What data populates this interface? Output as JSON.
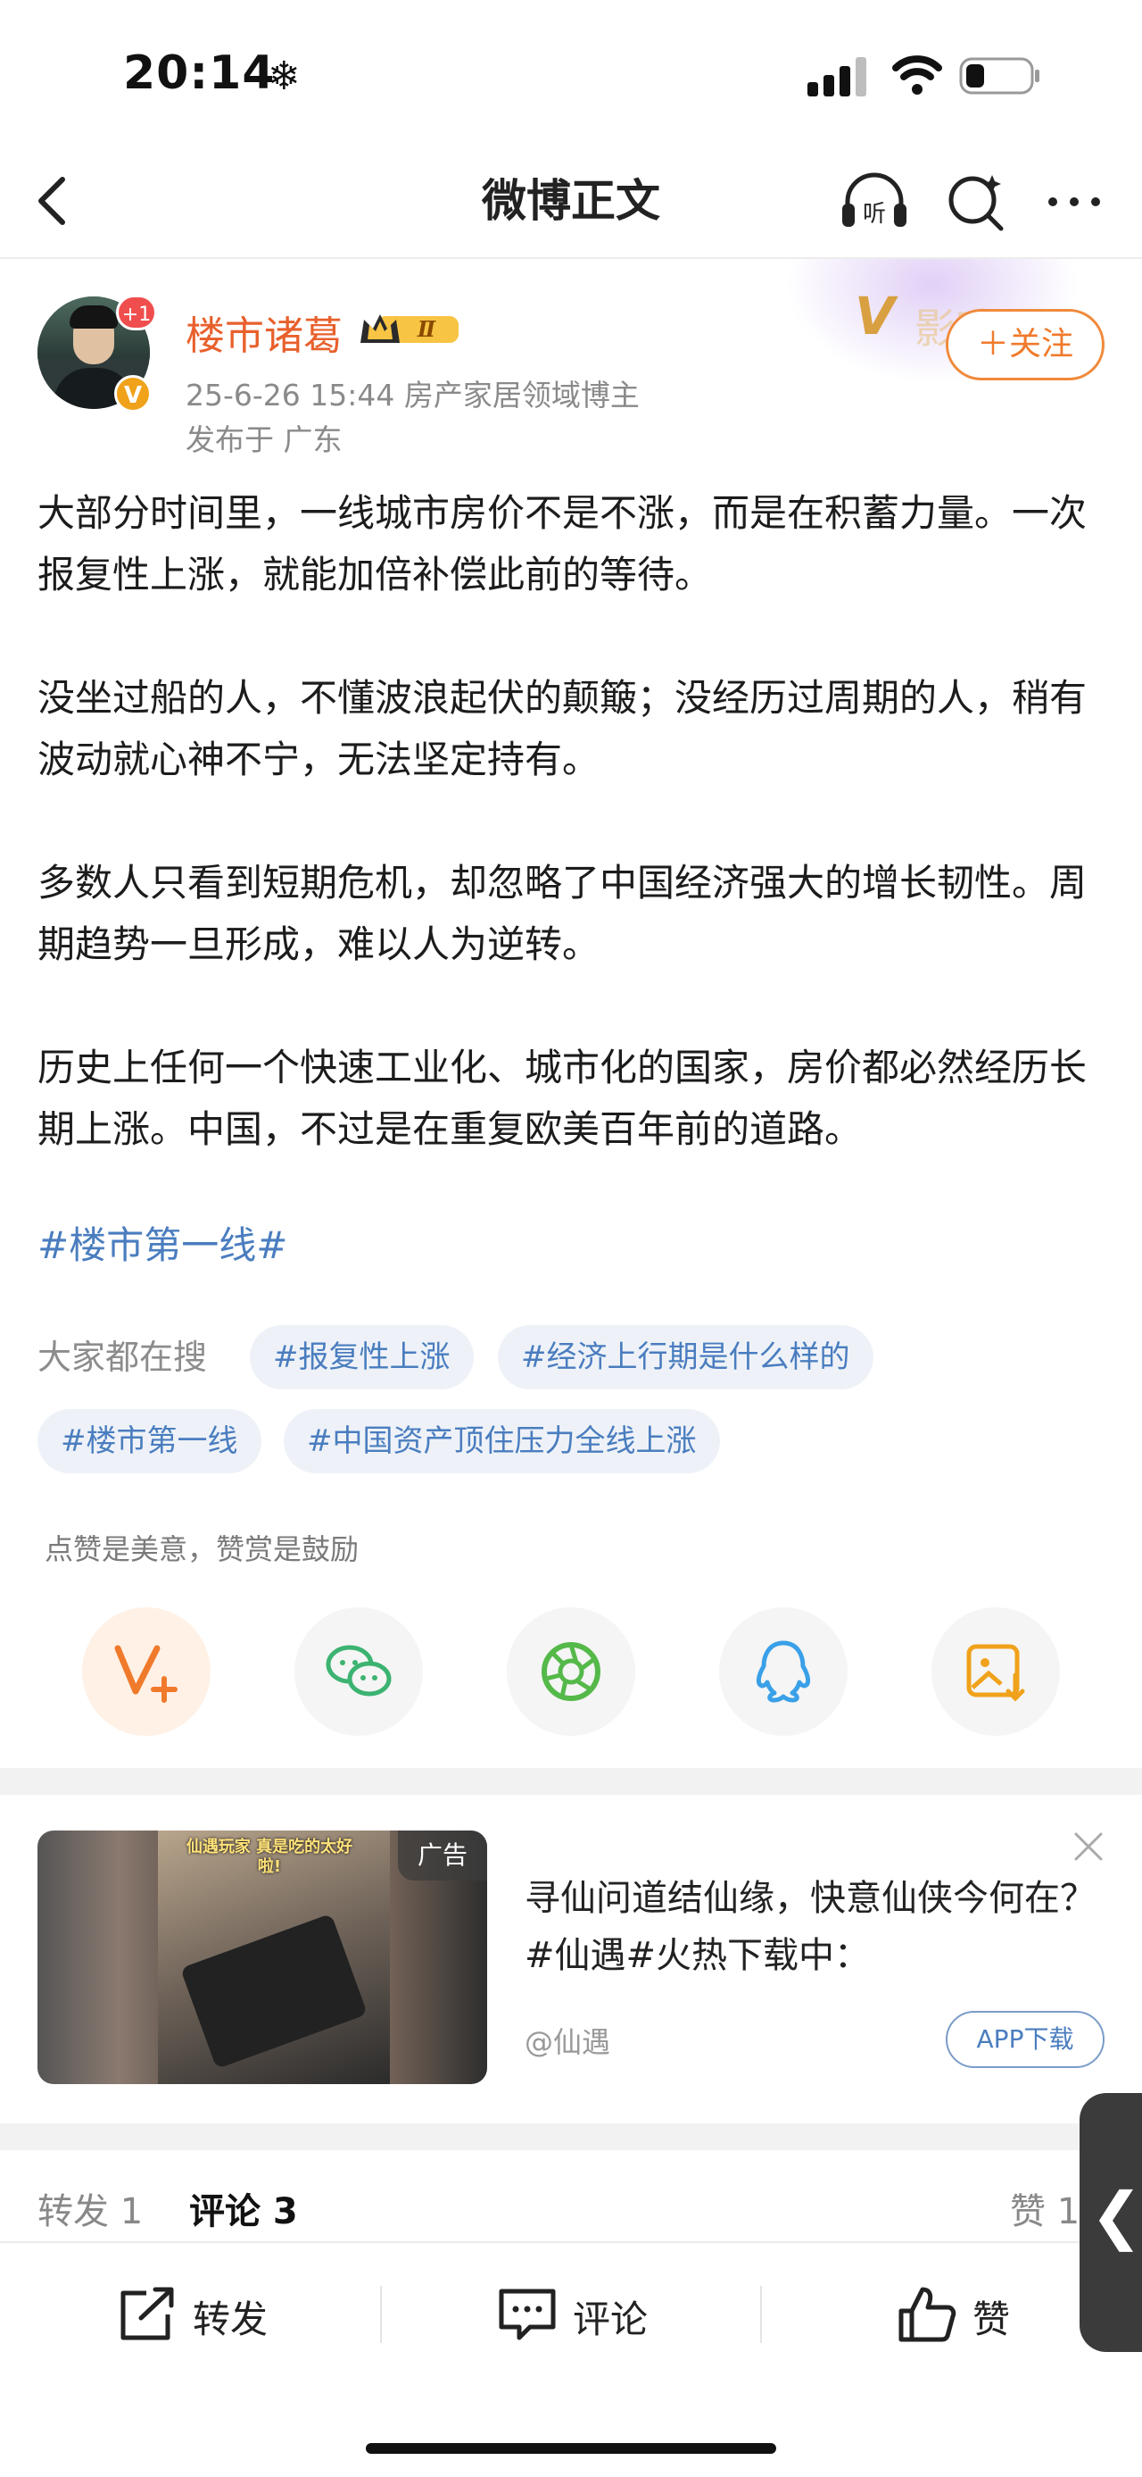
{
  "status_bar": {
    "time": "20:14",
    "snow_glyph": "❄"
  },
  "nav": {
    "title": "微博正文",
    "listen_label": "听"
  },
  "author": {
    "name": "楼市诸葛",
    "avatar_badge": "+1",
    "verified_glyph": "V",
    "crown_level": "Ⅱ",
    "meta": "25-6-26 15:44  房产家居领域博主",
    "location": "发布于 广东",
    "follow_label": "＋关注",
    "brand_logo": "V",
    "brand_text": "影响"
  },
  "post": {
    "paragraphs": [
      "大部分时间里，一线城市房价不是不涨，而是在积蓄力量。一次报复性上涨，就能加倍补偿此前的等待。",
      "没坐过船的人，不懂波浪起伏的颠簸；没经历过周期的人，稍有波动就心神不宁，无法坚定持有。",
      "多数人只看到短期危机，却忽略了中国经济强大的增长韧性。周期趋势一旦形成，难以人为逆转。",
      "历史上任何一个快速工业化、城市化的国家，房价都必然经历长期上涨。中国，不过是在重复欧美百年前的道路。"
    ],
    "hashtag": "#楼市第一线#"
  },
  "hot_search": {
    "label": "大家都在搜",
    "chips": [
      "#报复性上涨",
      "#经济上行期是什么样的",
      "#楼市第一线",
      "#中国资产顶住压力全线上涨"
    ]
  },
  "reward": {
    "text": "点赞是美意，赞赏是鼓励"
  },
  "ad": {
    "tag": "广告",
    "image_caption": "仙遇玩家 真是吃的太好啦!",
    "title": "寻仙问道结仙缘，快意仙侠今何在？#仙遇#火热下载中：",
    "source": "@仙遇",
    "download_label": "APP下载"
  },
  "tabs": {
    "repost": "转发 1",
    "comment": "评论 3",
    "like": "赞 1",
    "handle_glyph": "❮"
  },
  "bottom_bar": {
    "repost": "转发",
    "comment": "评论",
    "like": "赞"
  }
}
